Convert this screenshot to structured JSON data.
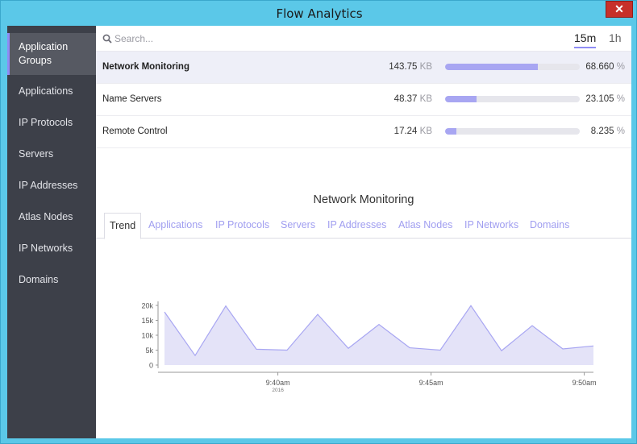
{
  "window": {
    "title": "Flow Analytics",
    "close_glyph": "✕"
  },
  "sidebar": {
    "items": [
      {
        "label": "Application Groups",
        "active": true
      },
      {
        "label": "Applications"
      },
      {
        "label": "IP Protocols"
      },
      {
        "label": "Servers"
      },
      {
        "label": "IP Addresses"
      },
      {
        "label": "Atlas Nodes"
      },
      {
        "label": "IP Networks"
      },
      {
        "label": "Domains"
      }
    ]
  },
  "search": {
    "placeholder": "Search..."
  },
  "time_range": {
    "options": [
      "15m",
      "1h"
    ],
    "selected": "15m"
  },
  "rows": [
    {
      "name": "Network Monitoring",
      "size": "143.75",
      "unit": "KB",
      "percent": "68.660",
      "pct_unit": "%",
      "fraction": 0.6866
    },
    {
      "name": "Name Servers",
      "size": "48.37",
      "unit": "KB",
      "percent": "23.105",
      "pct_unit": "%",
      "fraction": 0.23105
    },
    {
      "name": "Remote Control",
      "size": "17.24",
      "unit": "KB",
      "percent": "8.235",
      "pct_unit": "%",
      "fraction": 0.08235
    }
  ],
  "detail": {
    "title": "Network Monitoring",
    "tabs": [
      "Trend",
      "Applications",
      "IP Protocols",
      "Servers",
      "IP Addresses",
      "Atlas Nodes",
      "IP Networks",
      "Domains"
    ],
    "active_tab": "Trend"
  },
  "chart_data": {
    "type": "area",
    "y_ticks": [
      "20k",
      "15k",
      "10k",
      "5k",
      "0"
    ],
    "ylim": [
      0,
      20000
    ],
    "x_ticks": [
      {
        "label": "9:40am",
        "sub": "2016",
        "t": 3.7
      },
      {
        "label": "9:45am",
        "sub": "",
        "t": 8.7
      },
      {
        "label": "9:50am",
        "sub": "",
        "t": 13.7
      }
    ],
    "xlim": [
      0,
      14
    ],
    "values": [
      17800,
      3200,
      19800,
      5300,
      5000,
      17000,
      5600,
      13600,
      5800,
      5000,
      19900,
      4800,
      13200,
      5400,
      6400
    ],
    "fill": "#e4e3f8",
    "stroke": "#a8a6f2"
  },
  "colors": {
    "accent": "#8f8cf5",
    "sidebar": "#3d4049",
    "frame": "#5bc8e8"
  }
}
